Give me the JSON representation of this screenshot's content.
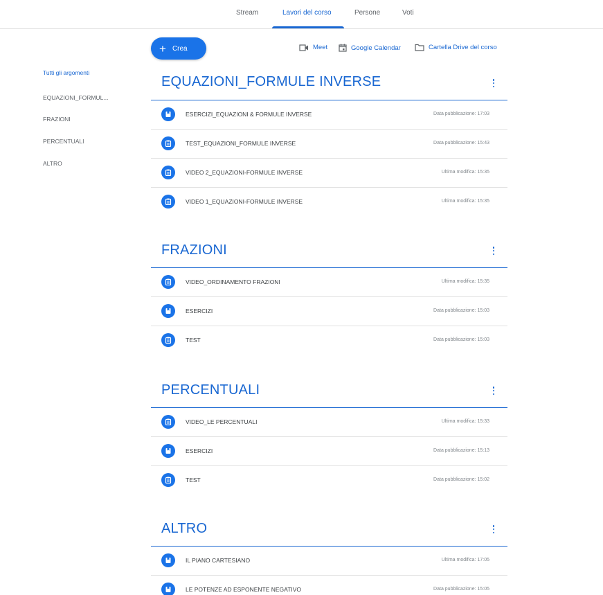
{
  "tabs": [
    {
      "label": "Stream"
    },
    {
      "label": "Lavori del corso"
    },
    {
      "label": "Persone"
    },
    {
      "label": "Voti"
    }
  ],
  "toolbar": {
    "create_label": "Crea",
    "meet_label": "Meet",
    "calendar_label": "Google Calendar",
    "drive_label": "Cartella Drive del corso"
  },
  "sidebar": {
    "items": [
      {
        "label": "Tutti gli argomenti"
      },
      {
        "label": "EQUAZIONI_FORMUL..."
      },
      {
        "label": "FRAZIONI"
      },
      {
        "label": "PERCENTUALI"
      },
      {
        "label": "ALTRO"
      }
    ]
  },
  "topics": [
    {
      "title": "EQUAZIONI_FORMULE INVERSE",
      "items": [
        {
          "icon": "assignment-icon",
          "title": "ESERCIZI_EQUAZIONI & FORMULE INVERSE",
          "date": "Data pubblicazione: 17:03"
        },
        {
          "icon": "quiz-assignment-icon",
          "title": "TEST_EQUAZIONI_FORMULE INVERSE",
          "date": "Data pubblicazione: 15:43"
        },
        {
          "icon": "material-icon",
          "title": "VIDEO 2_EQUAZIONI-FORMULE INVERSE",
          "date": "Ultima modifica: 15:35"
        },
        {
          "icon": "material-icon",
          "title": "VIDEO 1_EQUAZIONI-FORMULE INVERSE",
          "date": "Ultima modifica: 15:35"
        }
      ]
    },
    {
      "title": "FRAZIONI",
      "items": [
        {
          "icon": "material-icon",
          "title": "VIDEO_ORDINAMENTO FRAZIONI",
          "date": "Ultima modifica: 15:35"
        },
        {
          "icon": "assignment-icon",
          "title": "ESERCIZI",
          "date": "Data pubblicazione: 15:03"
        },
        {
          "icon": "material-icon",
          "title": "TEST",
          "date": "Data pubblicazione: 15:03"
        }
      ]
    },
    {
      "title": "PERCENTUALI",
      "items": [
        {
          "icon": "material-icon",
          "title": "VIDEO_LE PERCENTUALI",
          "date": "Ultima modifica: 15:33"
        },
        {
          "icon": "assignment-icon",
          "title": "ESERCIZI",
          "date": "Data pubblicazione: 15:13"
        },
        {
          "icon": "material-icon",
          "title": "TEST",
          "date": "Data pubblicazione: 15:02"
        }
      ]
    },
    {
      "title": "ALTRO",
      "items": [
        {
          "icon": "assignment-icon",
          "title": "IL PIANO CARTESIANO",
          "date": "Ultima modifica: 17:05"
        },
        {
          "icon": "assignment-icon",
          "title": "LE POTENZE AD ESPONENTE NEGATIVO",
          "date": "Data pubblicazione: 15:05"
        }
      ]
    }
  ],
  "colors": {
    "accent": "#1967d2",
    "button": "#1a73e8",
    "divider": "#e0e0e0",
    "meta_text": "#80868b"
  }
}
